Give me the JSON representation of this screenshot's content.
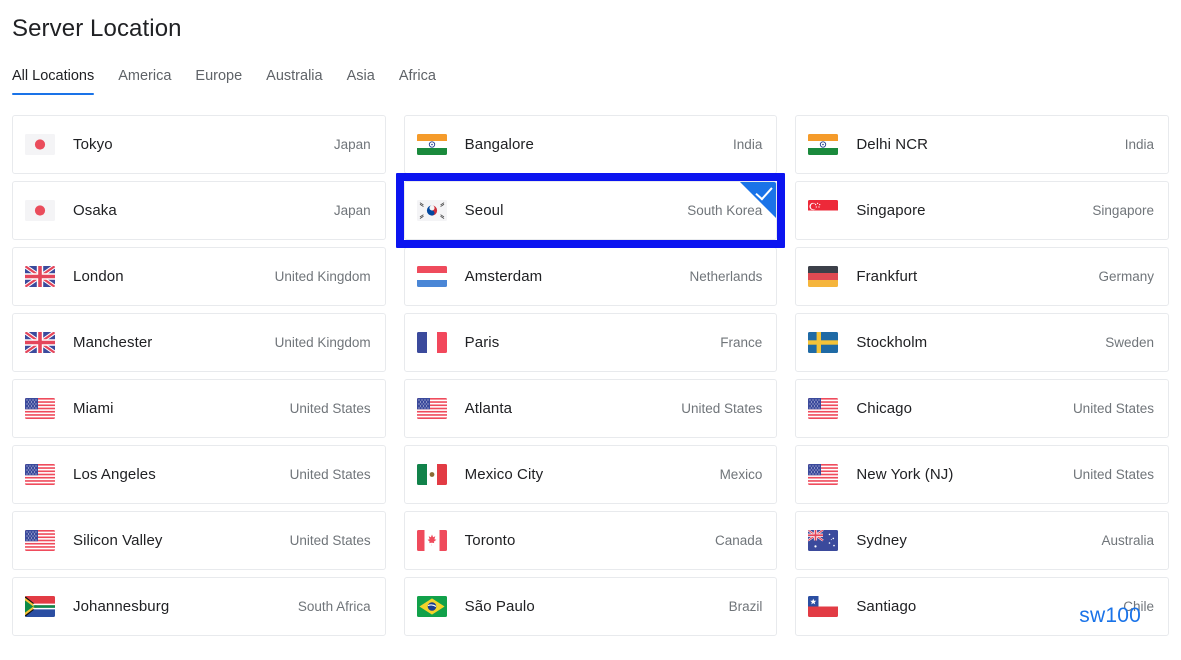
{
  "header": {
    "title": "Server Location"
  },
  "tabs": [
    {
      "label": "All Locations",
      "active": true
    },
    {
      "label": "America",
      "active": false
    },
    {
      "label": "Europe",
      "active": false
    },
    {
      "label": "Australia",
      "active": false
    },
    {
      "label": "Asia",
      "active": false
    },
    {
      "label": "Africa",
      "active": false
    }
  ],
  "colors": {
    "accent": "#1a73e8",
    "selection_border": "#0b14f0",
    "title_text": "#202124",
    "muted_text": "#70757a",
    "card_border": "#e8eaed"
  },
  "locations": [
    {
      "city": "Tokyo",
      "country": "Japan",
      "flag": "jp",
      "selected": false
    },
    {
      "city": "Bangalore",
      "country": "India",
      "flag": "in",
      "selected": false
    },
    {
      "city": "Delhi NCR",
      "country": "India",
      "flag": "in",
      "selected": false
    },
    {
      "city": "Osaka",
      "country": "Japan",
      "flag": "jp",
      "selected": false
    },
    {
      "city": "Seoul",
      "country": "South Korea",
      "flag": "kr",
      "selected": true
    },
    {
      "city": "Singapore",
      "country": "Singapore",
      "flag": "sg",
      "selected": false
    },
    {
      "city": "London",
      "country": "United Kingdom",
      "flag": "gb",
      "selected": false
    },
    {
      "city": "Amsterdam",
      "country": "Netherlands",
      "flag": "nl",
      "selected": false
    },
    {
      "city": "Frankfurt",
      "country": "Germany",
      "flag": "de",
      "selected": false
    },
    {
      "city": "Manchester",
      "country": "United Kingdom",
      "flag": "gb",
      "selected": false
    },
    {
      "city": "Paris",
      "country": "France",
      "flag": "fr",
      "selected": false
    },
    {
      "city": "Stockholm",
      "country": "Sweden",
      "flag": "se",
      "selected": false
    },
    {
      "city": "Miami",
      "country": "United States",
      "flag": "us",
      "selected": false
    },
    {
      "city": "Atlanta",
      "country": "United States",
      "flag": "us",
      "selected": false
    },
    {
      "city": "Chicago",
      "country": "United States",
      "flag": "us",
      "selected": false
    },
    {
      "city": "Los Angeles",
      "country": "United States",
      "flag": "us",
      "selected": false
    },
    {
      "city": "Mexico City",
      "country": "Mexico",
      "flag": "mx",
      "selected": false
    },
    {
      "city": "New York (NJ)",
      "country": "United States",
      "flag": "us",
      "selected": false
    },
    {
      "city": "Silicon Valley",
      "country": "United States",
      "flag": "us",
      "selected": false
    },
    {
      "city": "Toronto",
      "country": "Canada",
      "flag": "ca",
      "selected": false
    },
    {
      "city": "Sydney",
      "country": "Australia",
      "flag": "au",
      "selected": false
    },
    {
      "city": "Johannesburg",
      "country": "South Africa",
      "flag": "za",
      "selected": false
    },
    {
      "city": "São Paulo",
      "country": "Brazil",
      "flag": "br",
      "selected": false
    },
    {
      "city": "Santiago",
      "country": "Chile",
      "flag": "cl",
      "selected": false
    }
  ],
  "selection": {
    "badge_icon": "check-icon",
    "selected_city": "Seoul"
  },
  "watermark": {
    "text": "sw100"
  }
}
